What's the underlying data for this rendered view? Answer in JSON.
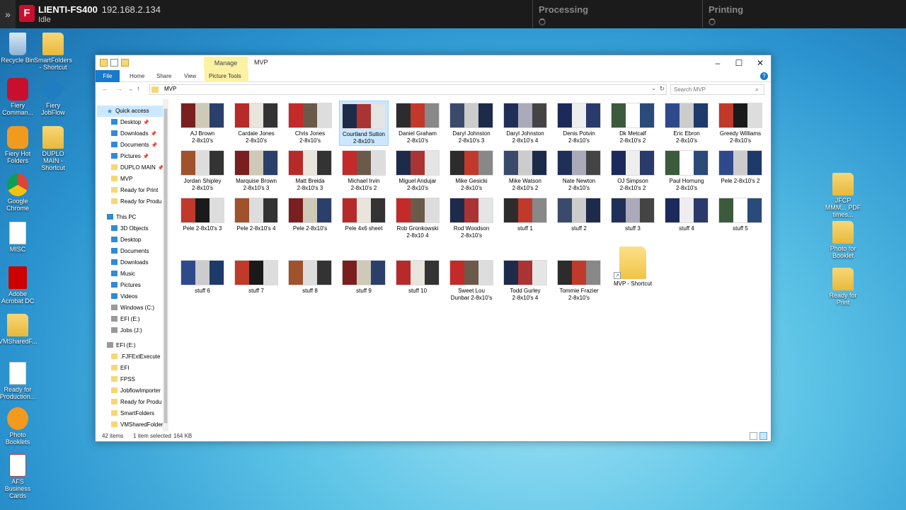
{
  "topbar": {
    "server": "LIENTI-FS400",
    "ip": "192.168.2.134",
    "state": "Idle",
    "processing": "Processing",
    "printing": "Printing"
  },
  "desktop": {
    "left_icons": [
      "Recycle Bin",
      "SmartFolders - Shortcut",
      "Fiery Comman...",
      "Fiery JobFlow",
      "Fiery Hot Folders",
      "DUPLO MAIN - Shortcut",
      "Google Chrome",
      "MISC",
      "Adobe Acrobat DC",
      "VMSharedF...",
      "Ready for Production...",
      "Photo Booklets",
      "AFS Business Cards"
    ],
    "right_icons": [
      "JFCP MMM... PDF times...",
      "Photo for Booklet",
      "Ready for Print"
    ]
  },
  "window": {
    "title": "MVP",
    "manage": "Manage",
    "ribbon_tabs": [
      "File",
      "Home",
      "Share",
      "View",
      "Picture Tools"
    ],
    "address": "MVP",
    "search_placeholder": "Search MVP",
    "status_count": "42 items",
    "status_selected": "1 item selected",
    "status_size": "164 KB"
  },
  "nav": [
    {
      "label": "Quick access",
      "icon": "star-icon"
    },
    {
      "label": "Desktop",
      "icon": "desktop-icon",
      "pin": true
    },
    {
      "label": "Downloads",
      "icon": "downloads-icon",
      "pin": true
    },
    {
      "label": "Documents",
      "icon": "documents-icon",
      "pin": true
    },
    {
      "label": "Pictures",
      "icon": "pictures-icon",
      "pin": true
    },
    {
      "label": "DUPLO MAIN",
      "icon": "folder-icon",
      "pin": true
    },
    {
      "label": "MVP",
      "icon": "folder-icon"
    },
    {
      "label": "Ready for Print",
      "icon": "folder-icon"
    },
    {
      "label": "Ready for Produ",
      "icon": "folder-icon"
    },
    {
      "label": "This PC",
      "icon": "pc-icon"
    },
    {
      "label": "3D Objects",
      "icon": "objects-icon"
    },
    {
      "label": "Desktop",
      "icon": "desktop-icon"
    },
    {
      "label": "Documents",
      "icon": "documents-icon"
    },
    {
      "label": "Downloads",
      "icon": "downloads-icon"
    },
    {
      "label": "Music",
      "icon": "music-icon"
    },
    {
      "label": "Pictures",
      "icon": "pictures-icon"
    },
    {
      "label": "Videos",
      "icon": "videos-icon"
    },
    {
      "label": "Windows (C:)",
      "icon": "drive-icon"
    },
    {
      "label": "EFI (E:)",
      "icon": "drive-icon"
    },
    {
      "label": "Jobs (J:)",
      "icon": "drive-icon"
    },
    {
      "label": "EFI (E:)",
      "icon": "drive-icon"
    },
    {
      "label": ".FJFExtExecute",
      "icon": "folder-icon"
    },
    {
      "label": "EFI",
      "icon": "folder-icon"
    },
    {
      "label": "FPSS",
      "icon": "folder-icon"
    },
    {
      "label": "JobflowImporter",
      "icon": "folder-icon"
    },
    {
      "label": "Ready for Produ",
      "icon": "folder-icon"
    },
    {
      "label": "SmartFolders",
      "icon": "folder-icon"
    },
    {
      "label": "VMSharedFolder",
      "icon": "folder-icon"
    }
  ],
  "files": [
    [
      "AJ Brown",
      "2-8x10's"
    ],
    [
      "Cardale Jones",
      "2-8x10's"
    ],
    [
      "Chris Jones",
      "2-8x10's"
    ],
    [
      "Courtland Sutton",
      "2-8x10's"
    ],
    [
      "Daniel  Graham",
      "2-8x10's"
    ],
    [
      "Daryl Johnston",
      "2-8x10's 3"
    ],
    [
      "Daryl Johnston",
      "2-8x10's 4"
    ],
    [
      "Denis Potvin",
      "2-8x10's"
    ],
    [
      "Dk Metcalf",
      "2-8x10's 2"
    ],
    [
      "Eric Ebron",
      "2-8x10's"
    ],
    [
      "Greedy Williams",
      "2-8x10's"
    ],
    [
      "Jordan Shipley",
      "2-8x10's"
    ],
    [
      "Marquise Brown",
      "2-8x10's 3"
    ],
    [
      "Matt Breida",
      "2-8x10's 3"
    ],
    [
      "Michael Irvin",
      "2-8x10's 2"
    ],
    [
      "Miguel Andujar",
      "2-8x10's"
    ],
    [
      "Mike Gesicki",
      "2-8x10's"
    ],
    [
      "Mike Watson",
      "2-8x10's 2"
    ],
    [
      "Nate Newton",
      "2-8x10's"
    ],
    [
      "OJ Simpson",
      "2-8x10's 2"
    ],
    [
      "Paul Hornung",
      "2-8x10's"
    ],
    [
      "Pele 2-8x10's 2",
      ""
    ],
    [
      "Pele 2-8x10's 3",
      ""
    ],
    [
      "Pele 2-8x10's 4",
      ""
    ],
    [
      "Pele 2-8x10's",
      ""
    ],
    [
      "Pele 4x6 sheet",
      ""
    ],
    [
      "Rob Gronkowski",
      "2-8x10 4"
    ],
    [
      "Rod Woodson",
      "2-8x10's"
    ],
    [
      "stuff 1",
      ""
    ],
    [
      "stuff 2",
      ""
    ],
    [
      "stuff 3",
      ""
    ],
    [
      "stuff 4",
      ""
    ],
    [
      "stuff 5",
      ""
    ],
    [
      "stuff 6",
      ""
    ],
    [
      "stuff 7",
      ""
    ],
    [
      "stuff 8",
      ""
    ],
    [
      "stuff 9",
      ""
    ],
    [
      "stuff 10",
      ""
    ],
    [
      "Sweet Lou",
      "Dunbar 2-8x10's"
    ],
    [
      "Todd Gurley",
      "2-8x10's 4"
    ],
    [
      "Tommie Frazier",
      "2-8x10's"
    ],
    [
      "MVP - Shortcut",
      ""
    ]
  ],
  "selected_index": 3
}
